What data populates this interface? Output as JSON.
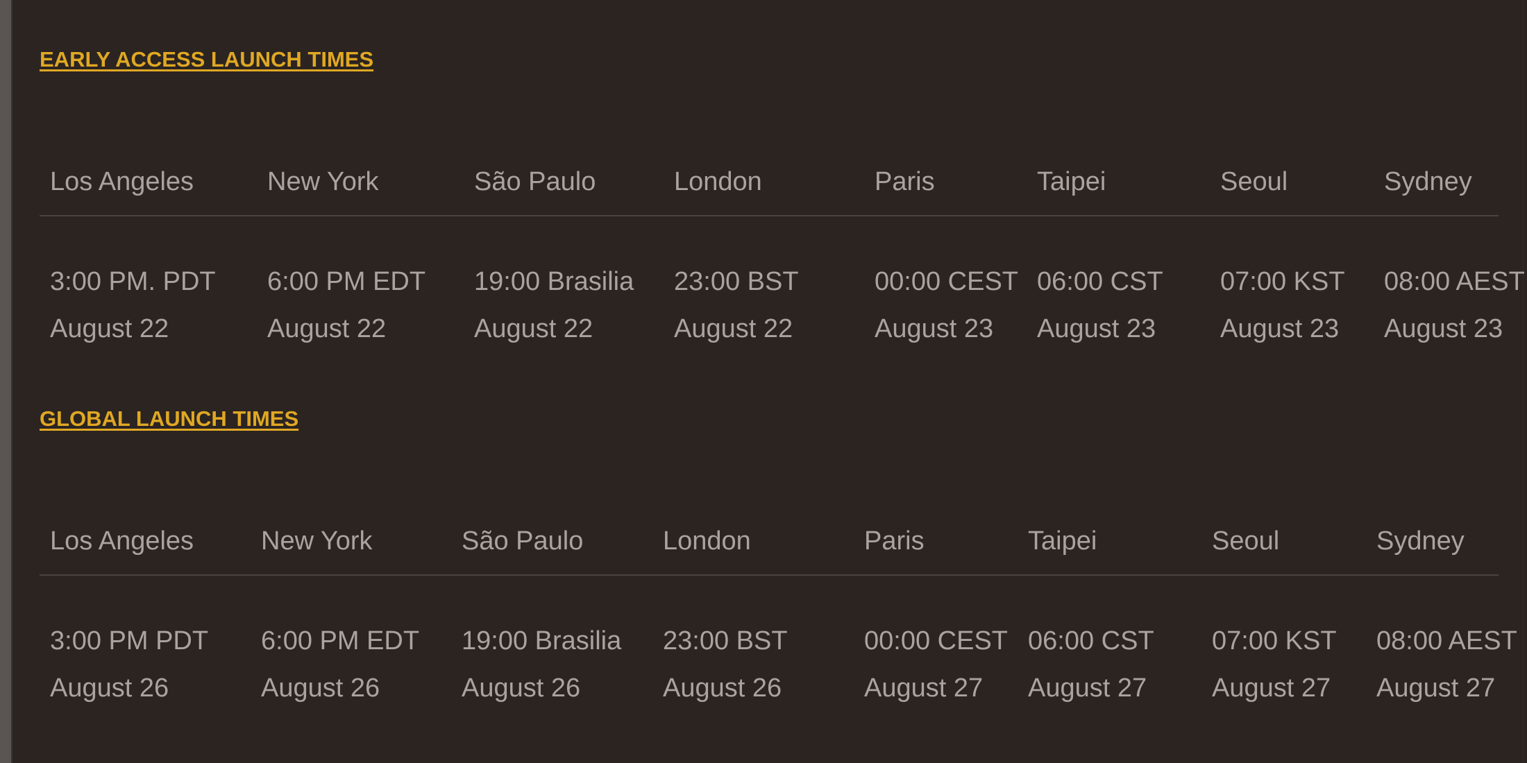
{
  "sections": [
    {
      "heading": "EARLY ACCESS LAUNCH TIMES",
      "columns": [
        {
          "city": "Los Angeles",
          "time": "3:00 PM. PDT",
          "date": "August 22"
        },
        {
          "city": "New York",
          "time": "6:00 PM EDT",
          "date": "August 22"
        },
        {
          "city": "São Paulo",
          "time": "19:00 Brasilia",
          "date": "August 22"
        },
        {
          "city": "London",
          "time": "23:00 BST",
          "date": "August 22"
        },
        {
          "city": "Paris",
          "time": "00:00 CEST",
          "date": "August 23"
        },
        {
          "city": "Taipei",
          "time": "06:00 CST",
          "date": "August 23"
        },
        {
          "city": "Seoul",
          "time": "07:00 KST",
          "date": "August 23"
        },
        {
          "city": "Sydney",
          "time": "08:00 AEST",
          "date": "August 23"
        }
      ]
    },
    {
      "heading": "GLOBAL LAUNCH TIMES",
      "columns": [
        {
          "city": "Los Angeles",
          "time": "3:00 PM PDT",
          "date": "August 26"
        },
        {
          "city": "New York",
          "time": "6:00 PM EDT",
          "date": "August 26"
        },
        {
          "city": "São Paulo",
          "time": "19:00 Brasilia",
          "date": "August 26"
        },
        {
          "city": "London",
          "time": "23:00 BST",
          "date": "August 26"
        },
        {
          "city": "Paris",
          "time": "00:00 CEST",
          "date": "August 27"
        },
        {
          "city": "Taipei",
          "time": "06:00 CST",
          "date": "August 27"
        },
        {
          "city": "Seoul",
          "time": "07:00 KST",
          "date": "August 27"
        },
        {
          "city": "Sydney",
          "time": "08:00 AEST",
          "date": "August 27"
        }
      ]
    }
  ],
  "colors": {
    "background": "#2b2421",
    "heading": "#e0a823",
    "text": "#aaa4a0",
    "divider": "#4a4441"
  }
}
